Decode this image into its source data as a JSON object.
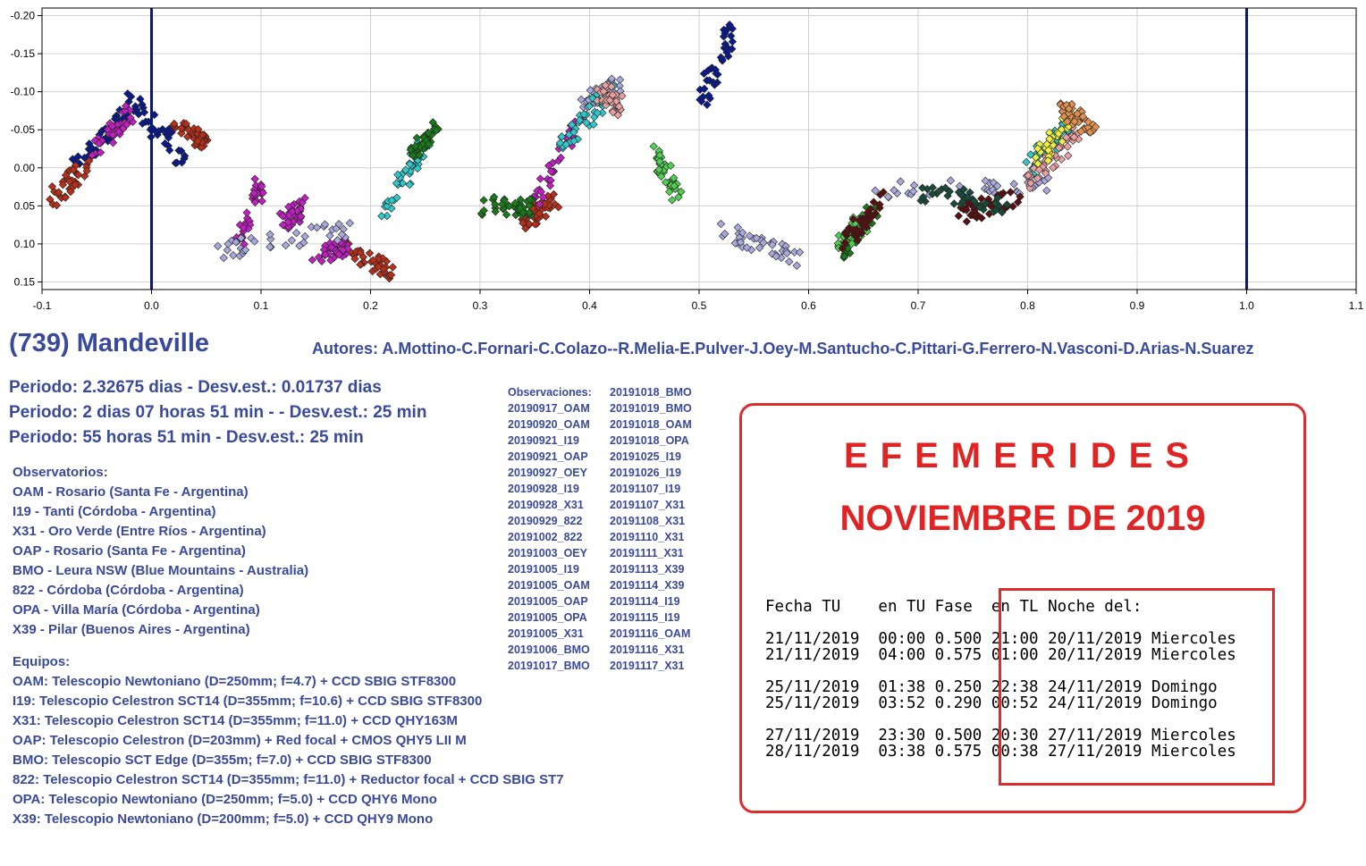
{
  "chart_data": {
    "type": "scatter",
    "title": "",
    "xlabel": "",
    "ylabel": "",
    "xlim": [
      -0.1,
      1.1
    ],
    "ylim": [
      0.16,
      -0.21
    ],
    "y_inverted": true,
    "x_ticks": [
      "-0.1",
      "0.0",
      "0.1",
      "0.2",
      "0.3",
      "0.4",
      "0.5",
      "0.6",
      "0.7",
      "0.8",
      "0.9",
      "1.0",
      "1.1"
    ],
    "y_ticks": [
      "-0.20",
      "-0.15",
      "-0.10",
      "-0.05",
      "0.00",
      "0.05",
      "0.10",
      "0.15"
    ],
    "vlines": [
      0.0,
      1.0
    ],
    "grid": true,
    "series_groups": [
      {
        "color": "#0a1a8c",
        "segments": [
          {
            "x0": -0.07,
            "x1": -0.02,
            "y0": 0.0,
            "y1": -0.08
          },
          {
            "x0": -0.02,
            "x1": 0.03,
            "y0": -0.09,
            "y1": -0.01
          },
          {
            "x0": 0.5,
            "x1": 0.53,
            "y0": -0.08,
            "y1": -0.18
          }
        ]
      },
      {
        "color": "#b8301a",
        "segments": [
          {
            "x0": -0.09,
            "x1": -0.06,
            "y0": 0.04,
            "y1": 0.0
          },
          {
            "x0": 0.02,
            "x1": 0.05,
            "y0": -0.06,
            "y1": -0.03
          },
          {
            "x0": 0.18,
            "x1": 0.22,
            "y0": 0.11,
            "y1": 0.14
          },
          {
            "x0": 0.34,
            "x1": 0.37,
            "y0": 0.07,
            "y1": 0.04
          }
        ]
      },
      {
        "color": "#c020c0",
        "segments": [
          {
            "x0": -0.05,
            "x1": -0.02,
            "y0": -0.02,
            "y1": -0.07
          },
          {
            "x0": 0.08,
            "x1": 0.1,
            "y0": 0.1,
            "y1": 0.02
          },
          {
            "x0": 0.12,
            "x1": 0.14,
            "y0": 0.07,
            "y1": 0.05
          },
          {
            "x0": 0.15,
            "x1": 0.18,
            "y0": 0.12,
            "y1": 0.1
          },
          {
            "x0": 0.35,
            "x1": 0.39,
            "y0": 0.04,
            "y1": -0.06
          }
        ]
      },
      {
        "color": "#a8a8dc",
        "segments": [
          {
            "x0": 0.06,
            "x1": 0.18,
            "y0": 0.11,
            "y1": 0.08
          },
          {
            "x0": 0.52,
            "x1": 0.59,
            "y0": 0.08,
            "y1": 0.12
          },
          {
            "x0": 0.66,
            "x1": 0.82,
            "y0": 0.03,
            "y1": 0.02
          },
          {
            "x0": 0.39,
            "x1": 0.43,
            "y0": -0.08,
            "y1": -0.11
          }
        ]
      },
      {
        "color": "#30c8c8",
        "segments": [
          {
            "x0": 0.21,
            "x1": 0.25,
            "y0": 0.06,
            "y1": -0.03
          },
          {
            "x0": 0.37,
            "x1": 0.42,
            "y0": -0.02,
            "y1": -0.1
          },
          {
            "x0": 0.8,
            "x1": 0.84,
            "y0": 0.0,
            "y1": -0.06
          }
        ]
      },
      {
        "color": "#1a7a1a",
        "segments": [
          {
            "x0": 0.24,
            "x1": 0.26,
            "y0": -0.02,
            "y1": -0.05
          },
          {
            "x0": 0.3,
            "x1": 0.35,
            "y0": 0.05,
            "y1": 0.05
          },
          {
            "x0": 0.63,
            "x1": 0.66,
            "y0": 0.11,
            "y1": 0.06
          }
        ]
      },
      {
        "color": "#50d050",
        "segments": [
          {
            "x0": 0.46,
            "x1": 0.48,
            "y0": -0.02,
            "y1": 0.04
          },
          {
            "x0": 0.63,
            "x1": 0.65,
            "y0": 0.1,
            "y1": 0.07
          }
        ]
      },
      {
        "color": "#5a1010",
        "segments": [
          {
            "x0": 0.63,
            "x1": 0.67,
            "y0": 0.1,
            "y1": 0.04
          },
          {
            "x0": 0.74,
            "x1": 0.79,
            "y0": 0.06,
            "y1": 0.04
          }
        ]
      },
      {
        "color": "#e8a0a0",
        "segments": [
          {
            "x0": 0.8,
            "x1": 0.85,
            "y0": 0.02,
            "y1": -0.05
          },
          {
            "x0": 0.41,
            "x1": 0.43,
            "y0": -0.1,
            "y1": -0.08
          }
        ]
      },
      {
        "color": "#f0f040",
        "segments": [
          {
            "x0": 0.81,
            "x1": 0.84,
            "y0": -0.01,
            "y1": -0.07
          }
        ]
      },
      {
        "color": "#e09050",
        "segments": [
          {
            "x0": 0.83,
            "x1": 0.86,
            "y0": -0.08,
            "y1": -0.05
          }
        ]
      },
      {
        "color": "#1a4a3a",
        "segments": [
          {
            "x0": 0.7,
            "x1": 0.78,
            "y0": 0.03,
            "y1": 0.05
          }
        ]
      }
    ]
  },
  "header": {
    "title": "(739) Mandeville",
    "authors": "Autores: A.Mottino-C.Fornari-C.Colazo--R.Melia-E.Pulver-J.Oey-M.Santucho-C.Pittari-G.Ferrero-N.Vasconi-D.Arias-N.Suarez"
  },
  "periods": [
    "Periodo: 2.32675 dias - Desv.est.: 0.01737 dias",
    "Periodo: 2 dias 07 horas 51 min -  - Desv.est.: 25 min",
    "Periodo: 55 horas 51 min - Desv.est.: 25 min"
  ],
  "observatories": {
    "heading": "Observatorios:",
    "items": [
      "OAM - Rosario (Santa Fe - Argentina)",
      "I19 - Tanti (Córdoba - Argentina)",
      "X31 - Oro Verde (Entre Ríos - Argentina)",
      "OAP - Rosario (Santa Fe - Argentina)",
      "BMO - Leura NSW (Blue Mountains - Australia)",
      "822 - Córdoba (Córdoba - Argentina)",
      "OPA - Villa María (Córdoba - Argentina)",
      "X39 - Pilar (Buenos Aires - Argentina)"
    ]
  },
  "equipment": {
    "heading": "Equipos:",
    "items": [
      "OAM: Telescopio Newtoniano (D=250mm; f=4.7) + CCD SBIG STF8300",
      "I19: Telescopio Celestron SCT14 (D=355mm; f=10.6) + CCD SBIG STF8300",
      "X31: Telescopio Celestron SCT14 (D=355mm; f=11.0) + CCD QHY163M",
      "OAP: Telescopio Celestron (D=203mm) + Red focal + CMOS QHY5 LII M",
      "BMO: Telescopio SCT Edge (D=355m; f=7.0) + CCD SBIG STF8300",
      "822: Telescopio Celestron SCT14 (D=355mm; f=11.0) + Reductor focal + CCD SBIG ST7",
      "OPA: Telescopio Newtoniano (D=250mm; f=5.0) + CCD QHY6 Mono",
      "X39: Telescopio Newtoniano (D=200mm; f=5.0) + CCD QHY9 Mono"
    ]
  },
  "observations": {
    "col1": [
      "Observaciones:",
      "20190917_OAM",
      "20190920_OAM",
      "20190921_I19",
      "20190921_OAP",
      "20190927_OEY",
      "20190928_I19",
      "20190928_X31",
      "20190929_822",
      "20191002_822",
      "20191003_OEY",
      "20191005_I19",
      "20191005_OAM",
      "20191005_OAP",
      "20191005_OPA",
      "20191005_X31",
      "20191006_BMO",
      "20191017_BMO"
    ],
    "col2": [
      "20191018_BMO",
      "20191019_BMO",
      "20191018_OAM",
      "20191018_OPA",
      "20191025_I19",
      "20191026_I19",
      "20191107_I19",
      "20191107_X31",
      "20191108_X31",
      "20191110_X31",
      "20191111_X31",
      "20191113_X39",
      "20191114_X39",
      "20191114_I19",
      "20191115_I19",
      "20191116_OAM",
      "20191116_X31",
      "20191117_X31"
    ]
  },
  "ephemerides": {
    "title": "EFEMERIDES",
    "month": "NOVIEMBRE DE 2019",
    "table": "Fecha TU    en TU Fase  en TL Noche del:\n\n21/11/2019  00:00 0.500 21:00 20/11/2019 Miercoles\n21/11/2019  04:00 0.575 01:00 20/11/2019 Miercoles\n\n25/11/2019  01:38 0.250 22:38 24/11/2019 Domingo\n25/11/2019  03:52 0.290 00:52 24/11/2019 Domingo\n\n27/11/2019  23:30 0.500 20:30 27/11/2019 Miercoles\n28/11/2019  03:38 0.575 00:38 27/11/2019 Miercoles",
    "accent_color": "#dc2d2d"
  }
}
